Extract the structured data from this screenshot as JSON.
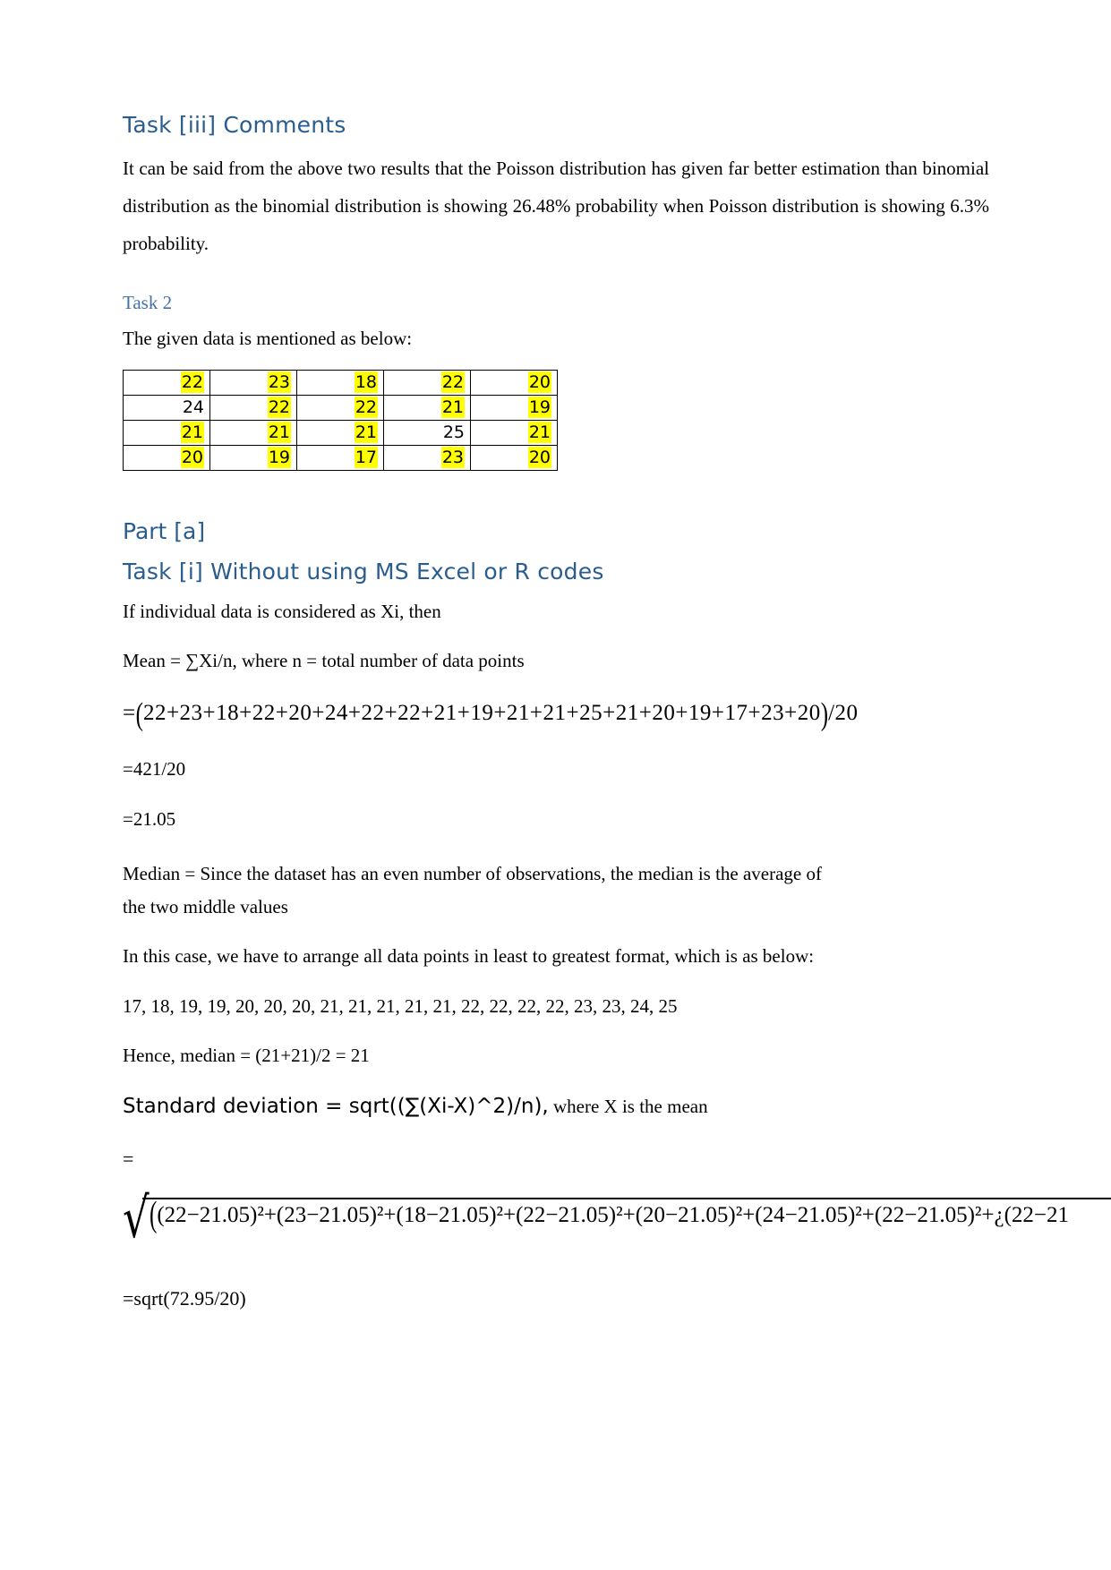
{
  "document": {
    "page_number_visible": false
  },
  "sections": {
    "task_iii": {
      "heading": "Task [iii] Comments",
      "paragraph": "It can be said from the above two results that the Poisson distribution has given far better estimation than binomial distribution as the binomial distribution is showing 26.48% probability when Poisson distribution is showing 6.3% probability.",
      "binomial_probability": "26.48%",
      "poisson_probability": "6.3%"
    },
    "task_2": {
      "heading": "Task 2",
      "intro": "The given data is mentioned as below:"
    },
    "part_a": {
      "heading": "Part [a]"
    },
    "task_i": {
      "heading": "Task [i] Without using MS Excel or R codes",
      "line_xi": "If individual data is considered as Xi, then",
      "mean_definition": "Mean = ∑Xi/n, where n = total number of data points",
      "mean_expansion_open": "=",
      "mean_expansion": "22+23+18+22+20+24+22+22+21+19+21+21+25+21+20+19+17+23+20",
      "mean_expansion_divisor": "/20",
      "mean_sum_over_n": "=421/20",
      "mean_result": "=21.05",
      "median_definition_line1": "Median = Since the dataset has an even number of observations, the median is the average of",
      "median_definition_line2": "the two middle values",
      "sorting_intro": "In this case, we have to arrange all data points in least to greatest format, which is as below:",
      "sorted_data": "17, 18, 19, 19, 20, 20, 20, 21, 21, 21, 21, 21, 22, 22, 22, 22, 23, 23, 24, 25",
      "median_result": "Hence, median = (21+21)/2 = 21",
      "sd_heading_main": "Standard deviation = sqrt((∑(Xi-X)^2)/n),",
      "sd_heading_tail": " where X is the mean",
      "sd_equals": "=",
      "sd_radical_terms": "(22−21.05)²+(23−21.05)²+(18−21.05)²+(22−21.05)²+(20−21.05)²+(24−21.05)²+(22−21.05)²+¿(22−21",
      "sd_result": "=sqrt(72.95/20)"
    }
  },
  "data_table": {
    "columns": 5,
    "rows": [
      [
        {
          "value": "22",
          "highlighted": true
        },
        {
          "value": "23",
          "highlighted": true
        },
        {
          "value": "18",
          "highlighted": true
        },
        {
          "value": "22",
          "highlighted": true
        },
        {
          "value": "20",
          "highlighted": true
        }
      ],
      [
        {
          "value": "24",
          "highlighted": false
        },
        {
          "value": "22",
          "highlighted": true
        },
        {
          "value": "22",
          "highlighted": true
        },
        {
          "value": "21",
          "highlighted": true
        },
        {
          "value": "19",
          "highlighted": true
        }
      ],
      [
        {
          "value": "21",
          "highlighted": true
        },
        {
          "value": "21",
          "highlighted": true
        },
        {
          "value": "21",
          "highlighted": true
        },
        {
          "value": "25",
          "highlighted": false
        },
        {
          "value": "21",
          "highlighted": true
        }
      ],
      [
        {
          "value": "20",
          "highlighted": true
        },
        {
          "value": "19",
          "highlighted": true
        },
        {
          "value": "17",
          "highlighted": true
        },
        {
          "value": "23",
          "highlighted": true
        },
        {
          "value": "20",
          "highlighted": true
        }
      ]
    ]
  },
  "colors": {
    "heading_blue": "#2a5d8f",
    "subheading_blue": "#4472a8",
    "highlight_yellow": "#ffff00",
    "text_black": "#000000",
    "page_background": "#ffffff"
  }
}
